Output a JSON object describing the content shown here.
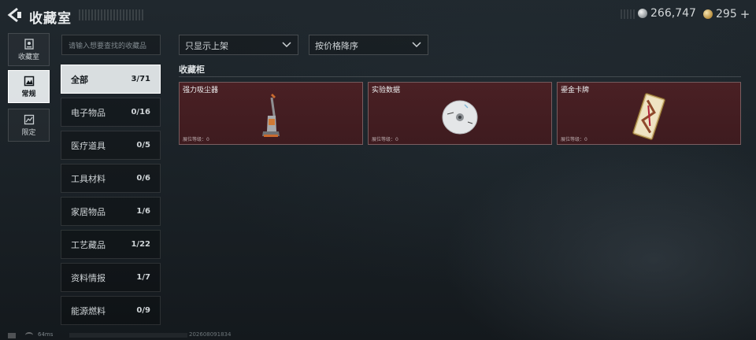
{
  "header": {
    "title": "收藏室",
    "currency": [
      {
        "icon": "silver-coin-icon",
        "value": "266,747"
      },
      {
        "icon": "gold-coin-icon",
        "value": "295",
        "suffix": "+"
      }
    ]
  },
  "nav": [
    {
      "label": "收藏室",
      "icon": "collection-room-icon",
      "active": false
    },
    {
      "label": "常规",
      "icon": "regular-icon",
      "active": true
    },
    {
      "label": "限定",
      "icon": "limited-icon",
      "active": false
    }
  ],
  "search": {
    "placeholder": "请输入想要查找的收藏品"
  },
  "filters": {
    "show_filter": "只显示上架",
    "sort": "按价格降序"
  },
  "categories": [
    {
      "name": "全部",
      "count": "3/71",
      "active": true
    },
    {
      "name": "电子物品",
      "count": "0/16"
    },
    {
      "name": "医疗道具",
      "count": "0/5"
    },
    {
      "name": "工具材料",
      "count": "0/6"
    },
    {
      "name": "家居物品",
      "count": "1/6"
    },
    {
      "name": "工艺藏品",
      "count": "1/22"
    },
    {
      "name": "资料情报",
      "count": "1/7"
    },
    {
      "name": "能源燃料",
      "count": "0/9"
    }
  ],
  "section": {
    "title": "收藏柜"
  },
  "items": [
    {
      "name": "强力吸尘器",
      "level": "展位等级：0",
      "icon": "vacuum-cleaner-icon"
    },
    {
      "name": "实验数据",
      "level": "展位等级：0",
      "icon": "disc-icon"
    },
    {
      "name": "鎏金卡牌",
      "level": "展位等级：0",
      "icon": "gilded-card-icon"
    }
  ],
  "status": {
    "ping": "64ms",
    "version": "202608091834"
  },
  "colors": {
    "card_bg": "#4a2024",
    "active_bg": "#e4e8ea",
    "page_bg": "#1a2126"
  }
}
